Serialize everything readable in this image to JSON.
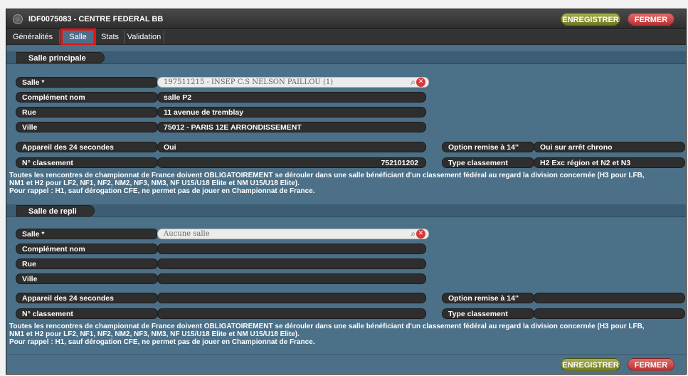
{
  "window": {
    "title": "IDF0075083 - CENTRE FEDERAL BB",
    "save_label": "ENREGISTRER",
    "close_label": "FERMER"
  },
  "tabs": [
    {
      "label": "Généralités",
      "active": false
    },
    {
      "label": "Salle",
      "active": true
    },
    {
      "label": "Stats",
      "active": false
    },
    {
      "label": "Validation",
      "active": false
    }
  ],
  "principal": {
    "section_title": "Salle principale",
    "salle_label": "Salle *",
    "salle_value": "197511215 - INSEP C.S NELSON PAILLOU (1)",
    "complement_label": "Complément nom",
    "complement_value": "salle P2",
    "rue_label": "Rue",
    "rue_value": "11 avenue de tremblay",
    "ville_label": "Ville",
    "ville_value": "75012 - PARIS 12E ARRONDISSEMENT",
    "appareil_label": "Appareil des 24 secondes",
    "appareil_value": "Oui",
    "option_label": "Option remise à 14''",
    "option_value": "Oui sur arrêt chrono",
    "classement_label": "N° classement",
    "classement_value": "752101202",
    "type_label": "Type classement",
    "type_value": "H2 Exc région et N2 et N3",
    "info_line1": "Toutes les rencontres de championnat de France doivent OBLIGATOIREMENT se dérouler dans une salle bénéficiant d'un classement fédéral au regard la division concernée (H3 pour LFB,",
    "info_line2": "NM1 et H2 pour LF2, NF1, NF2, NM2, NF3, NM3, NF U15/U18 Elite et NM U15/U18 Elite).",
    "info_line3": "Pour rappel : H1, sauf dérogation CFE, ne permet pas de jouer en Championnat de France."
  },
  "repli": {
    "section_title": "Salle de repli",
    "salle_label": "Salle *",
    "salle_placeholder": "Aucune salle",
    "complement_label": "Complément nom",
    "rue_label": "Rue",
    "ville_label": "Ville",
    "appareil_label": "Appareil des 24 secondes",
    "option_label": "Option remise à 14''",
    "classement_label": "N° classement",
    "type_label": "Type classement",
    "info_line1": "Toutes les rencontres de championnat de France doivent OBLIGATOIREMENT se dérouler dans une salle bénéficiant d'un classement fédéral au regard la division concernée (H3 pour LFB,",
    "info_line2": "NM1 et H2 pour LF2, NF1, NF2, NM2, NF3, NM3, NF U15/U18 Elite et NM U15/U18 Elite).",
    "info_line3": "Pour rappel : H1, sauf dérogation CFE, ne permet pas de jouer en Championnat de France."
  },
  "icons": {
    "search": "search-icon",
    "clear": "clear-icon",
    "logo": "logo-icon"
  },
  "colors": {
    "save": "#8a9436",
    "close": "#c94545",
    "content": "#4b7088",
    "active_tab": "#4e6f8a"
  }
}
